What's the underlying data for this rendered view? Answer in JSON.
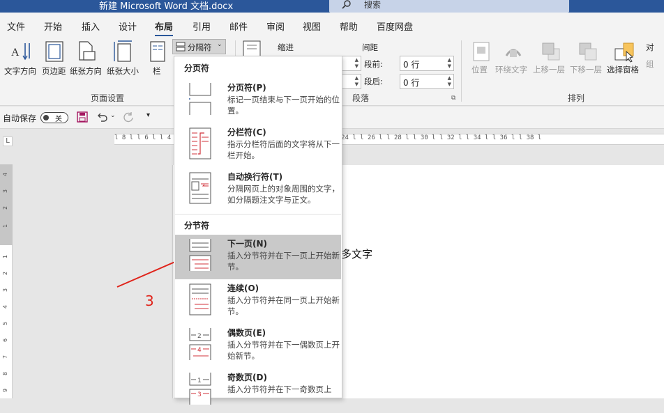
{
  "titlebar": {
    "title": "新建 Microsoft Word 文档.docx",
    "search_label": "搜索"
  },
  "tabs": [
    "文件",
    "开始",
    "插入",
    "设计",
    "布局",
    "引用",
    "邮件",
    "审阅",
    "视图",
    "帮助",
    "百度网盘"
  ],
  "ribbon": {
    "page_setup": {
      "buttons": [
        "文字方向",
        "页边距",
        "纸张方向",
        "纸张大小",
        "栏"
      ],
      "group_label": "页面设置",
      "breaks_label": "分隔符"
    },
    "paragraph": {
      "indent_label": "缩进",
      "spacing_label": "间距",
      "before_label": "段前:",
      "before_value": "0 行",
      "after_label": "段后:",
      "after_value": "0 行",
      "group_label": "段落"
    },
    "arrange": {
      "buttons": [
        "位置",
        "环绕文字",
        "上移一层",
        "下移一层",
        "选择窗格"
      ],
      "group_label": "排列",
      "partial_right_1": "对",
      "partial_right_2": "组"
    }
  },
  "qat": {
    "autosave_label": "自动保存",
    "toggle_state": "关"
  },
  "hruler_text": "l 8 l   l 6 l   l 4      l 12 l   l 14 l   l 16 l   l 18 l   l 20 l   l 22 l   l 24 l   l 26 l   l 28 l   l 30 l   l 32 l   l 34 l   l 36 l   l 38 l",
  "vruler_ticks": [
    "4",
    "3",
    "2",
    "1",
    "1",
    "2",
    "3",
    "4",
    "5",
    "6",
    "7",
    "8",
    "9"
  ],
  "document": {
    "visible_text": "多文字"
  },
  "dropdown": {
    "page_breaks_header": "分页符",
    "section_breaks_header": "分节符",
    "items": [
      {
        "title": "分页符(P)",
        "desc": "标记一页结束与下一页开始的位置。"
      },
      {
        "title": "分栏符(C)",
        "desc": "指示分栏符后面的文字将从下一栏开始。"
      },
      {
        "title": "自动换行符(T)",
        "desc": "分隔网页上的对象周围的文字，如分隔题注文字与正文。"
      },
      {
        "title": "下一页(N)",
        "desc": "插入分节符并在下一页上开始新节。"
      },
      {
        "title": "连续(O)",
        "desc": "插入分节符并在同一页上开始新节。"
      },
      {
        "title": "偶数页(E)",
        "desc": "插入分节符并在下一偶数页上开始新节。"
      },
      {
        "title": "奇数页(D)",
        "desc": "插入分节符并在下一奇数页上"
      }
    ]
  },
  "annotation": {
    "number": "3",
    "color": "#e0241b"
  },
  "colors": {
    "accent": "#2b579a",
    "highlight": "#c9c9c9",
    "break_red": "#d0323a"
  }
}
